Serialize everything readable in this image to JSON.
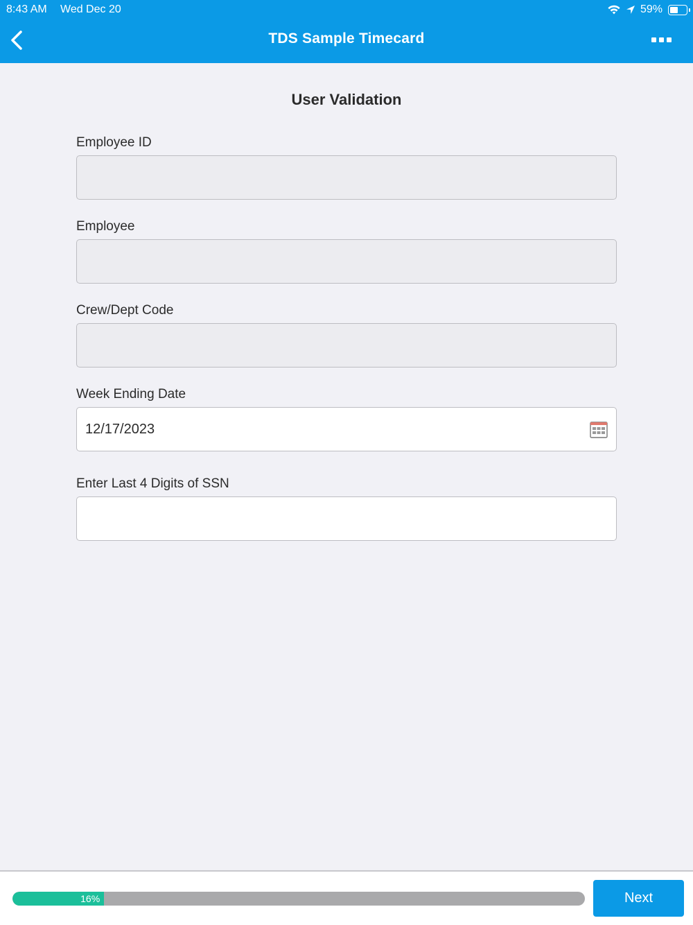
{
  "status_bar": {
    "time": "8:43 AM",
    "date": "Wed Dec 20",
    "battery_percent": "59%",
    "battery_level": 0.59,
    "icons": [
      "wifi-icon",
      "location-arrow-icon",
      "battery-icon"
    ]
  },
  "nav": {
    "title": "TDS Sample Timecard",
    "back_icon": "chevron-left-icon",
    "more_icon": "more-dots-icon"
  },
  "form": {
    "section_title": "User Validation",
    "employee_id": {
      "label": "Employee ID",
      "value": ""
    },
    "employee": {
      "label": "Employee",
      "value": ""
    },
    "crew_dept_code": {
      "label": "Crew/Dept Code",
      "value": ""
    },
    "week_ending_date": {
      "label": "Week Ending Date",
      "value": "12/17/2023",
      "icon": "calendar-icon"
    },
    "ssn_last4": {
      "label": "Enter Last 4 Digits of SSN",
      "value": ""
    }
  },
  "footer": {
    "progress_label": "16%",
    "progress_value": 0.16,
    "next_label": "Next"
  },
  "colors": {
    "primary": "#0b9ae6",
    "progress_fill": "#1bbf9a",
    "progress_track": "#a9a9ab",
    "background": "#f1f1f6"
  }
}
